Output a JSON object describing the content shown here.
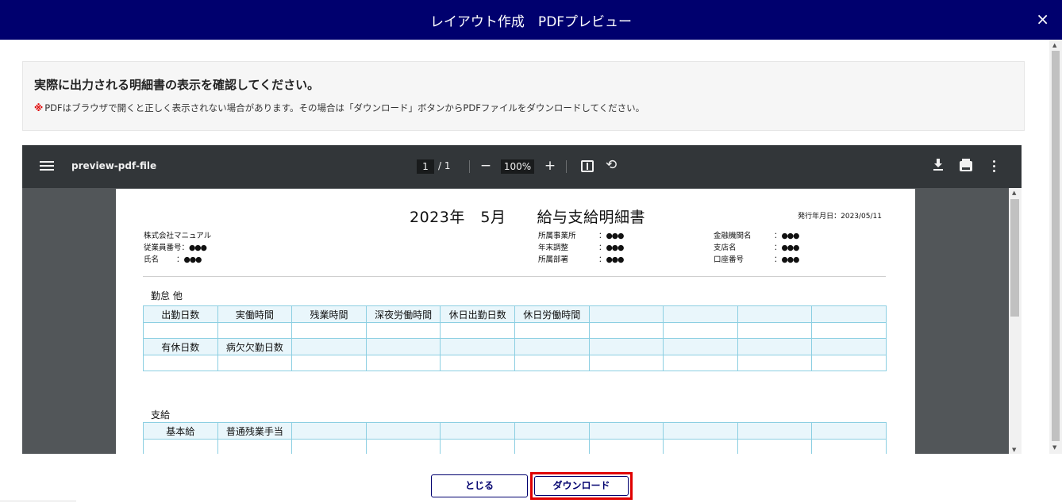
{
  "dialog": {
    "title": "レイアウト作成　PDFプレビュー",
    "close_glyph": "×"
  },
  "notice": {
    "heading": "実際に出力される明細書の表示を確認してください。",
    "mark": "※",
    "text": "PDFはブラウザで開くと正しく表示されない場合があります。その場合は「ダウンロード」ボタンからPDFファイルをダウンロードしてください。"
  },
  "viewer": {
    "filename": "preview-pdf-file",
    "page_current": "1",
    "page_total": "/  1",
    "zoom": "100%",
    "zoom_out": "−",
    "zoom_in": "+",
    "rotate_glyph": "⟲"
  },
  "document": {
    "title": "2023年　5月　　給与支給明細書",
    "issue_label": "発行年月日：",
    "issue_date": "2023/05/11",
    "company": "株式会社マニュアル",
    "employee_no_label": "従業員番号：",
    "name_label": "氏名　　 ：",
    "masked": "●●●",
    "mid_labels": [
      "所属事業所",
      "年末調整",
      "所属部署"
    ],
    "right_labels": [
      "金融機関名",
      "支店名",
      "口座番号"
    ],
    "colon": "：",
    "section_attendance": "勤怠 他",
    "attendance_row1": [
      "出勤日数",
      "実働時間",
      "残業時間",
      "深夜労働時間",
      "休日出勤日数",
      "休日労働時間",
      "",
      "",
      "",
      ""
    ],
    "attendance_row2": [
      "有休日数",
      "病欠欠勤日数",
      "",
      "",
      "",
      "",
      "",
      "",
      "",
      ""
    ],
    "section_pay": "支給",
    "pay_row1": [
      "基本給",
      "普通残業手当",
      "",
      "",
      "",
      "",
      "",
      "",
      "",
      ""
    ]
  },
  "footer": {
    "close_label": "とじる",
    "download_label": "ダウンロード"
  },
  "colors": {
    "header": "#00006e",
    "highlight": "#e00000",
    "table_border": "#8ccfe2"
  }
}
